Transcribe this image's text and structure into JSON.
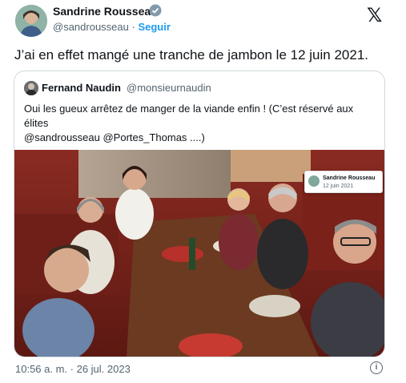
{
  "tweet": {
    "author_name": "Sandrine Rousseau",
    "author_handle": "@sandrousseau",
    "separator": "·",
    "follow_label": "Seguir",
    "text": "J’ai en effet mangé une tranche de jambon le 12 juin 2021.",
    "timestamp": "10:56 a. m. · 26 jul. 2023"
  },
  "quote": {
    "author_name": "Fernand Naudin",
    "author_handle": "@monsieurnaudin",
    "text": "Oui les gueux arrêtez de manger de la viande enfin ! (C’est réservé aux élites",
    "mentions": "@sandrousseau @Portes_Thomas ....)"
  },
  "photo_inset": {
    "name": "Sandrine Rousseau",
    "date": "12 juin 2021"
  },
  "icons": {
    "verified": "verified-badge-icon",
    "platform_logo": "x-logo-icon",
    "info": "info-icon"
  },
  "colors": {
    "accent": "#1d9bf0",
    "text": "#0f1419",
    "muted": "#536471",
    "border": "#cfd9de"
  }
}
